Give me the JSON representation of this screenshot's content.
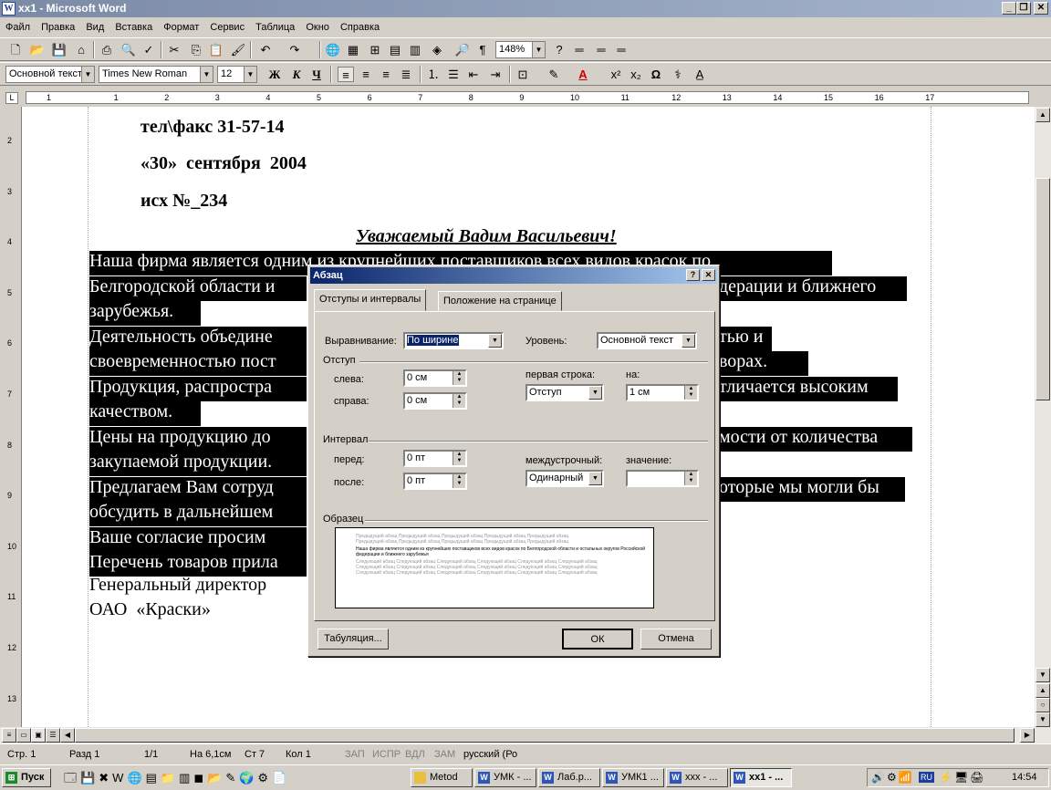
{
  "window": {
    "title": "xx1 - Microsoft Word",
    "icon": "W"
  },
  "menu": [
    "Файл",
    "Правка",
    "Вид",
    "Вставка",
    "Формат",
    "Сервис",
    "Таблица",
    "Окно",
    "Справка"
  ],
  "toolbar": {
    "zoom": "148%"
  },
  "format": {
    "style": "Основной текст",
    "font": "Times New Roman",
    "size": "12",
    "bold": "Ж",
    "italic": "К",
    "underline": "Ч",
    "omega": "Ω"
  },
  "ruler": {
    "ticks": [
      "1",
      "1",
      "2",
      "3",
      "4",
      "5",
      "6",
      "7",
      "8",
      "9",
      "10",
      "11",
      "12",
      "13",
      "14",
      "15",
      "16",
      "17"
    ]
  },
  "vruler": {
    "ticks": [
      "2",
      "3",
      "4",
      "5",
      "6",
      "7",
      "8",
      "9",
      "10",
      "11",
      "12",
      "13"
    ]
  },
  "document": {
    "lines": [
      "тел\\факс 31-57-14",
      "«30»  сентября  2004",
      "исх №_234",
      "Уважаемый Вадим Васильевич!",
      "Наша фирма является одним из крупнейших поставщиков всех видов красок по",
      "Белгородской области и",
      "дерации и ближнего",
      "зарубежья.",
      "Деятельность объедине",
      "тью и",
      "своевременностью пост",
      "ворах.",
      "Продукция, распростра",
      "тличается высоким",
      "качеством.",
      "Цены на продукцию до",
      "мости от количества",
      "закупаемой продукции.",
      "Предлагаем Вам сотруд",
      "оторые мы могли бы",
      "обсудить в дальнейшем",
      "Ваше согласие просим",
      "Перечень товаров прила",
      "Генеральный директор",
      "ОАО  «Краски»"
    ]
  },
  "dialog": {
    "title": "Абзац",
    "tabs": [
      "Отступы и интервалы",
      "Положение на странице"
    ],
    "alignment_label": "Выравнивание:",
    "alignment_value": "По ширине",
    "level_label": "Уровень:",
    "level_value": "Основной текст",
    "indent_group": "Отступ",
    "left_label": "слева:",
    "left_value": "0 см",
    "right_label": "справа:",
    "right_value": "0 см",
    "first_line_label": "первая строка:",
    "first_line_value": "Отступ",
    "on_label": "на:",
    "on_value": "1 см",
    "spacing_group": "Интервал",
    "before_label": "перед:",
    "before_value": "0 пт",
    "after_label": "после:",
    "after_value": "0 пт",
    "line_spacing_label": "междустрочный:",
    "line_spacing_value": "Одинарный",
    "value_label": "значение:",
    "value_value": "",
    "sample_group": "Образец",
    "sample_prev": "Предыдущий абзац Предыдущий абзац Предыдущий абзац Предыдущий абзац Предыдущий абзац",
    "sample_cur": "Наша фирма является одним из крупнейших поставщиков всех видов красок по Белгородской области и остальных округов Российской федерации и ближнего зарубежья",
    "sample_next": "Следующий абзац Следующий абзац Следующий абзац Следующий абзац Следующий абзац Следующий абзац",
    "tabs_button": "Табуляция...",
    "ok_button": "ОК",
    "cancel_button": "Отмена"
  },
  "status": {
    "page": "Стр. 1",
    "section": "Разд 1",
    "pages": "1/1",
    "at": "На 6,1см",
    "line": "Ст 7",
    "col": "Кол 1",
    "rec": "ЗАП",
    "trk": "ИСПР",
    "ext": "ВДЛ",
    "ovr": "ЗАМ",
    "lang": "русский (Ро"
  },
  "taskbar": {
    "start": "Пуск",
    "items": [
      "Metod",
      "УМК - ...",
      "Лаб.р...",
      "УМК1 ...",
      "xxx - ...",
      "xx1 - ..."
    ],
    "lang": "RU",
    "clock": "14:54"
  }
}
